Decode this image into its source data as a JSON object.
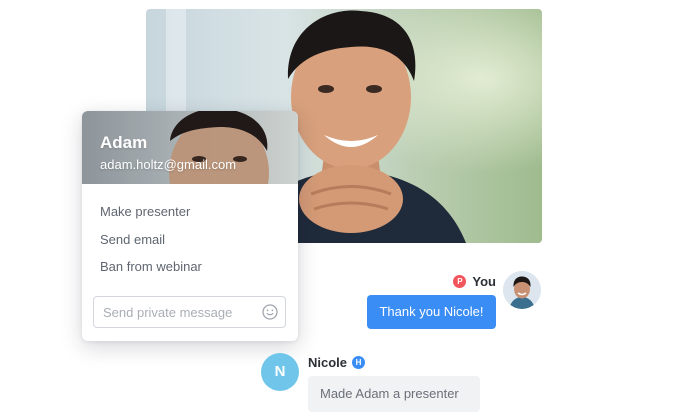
{
  "video": {
    "image": "presenter-video-frame"
  },
  "profile_card": {
    "name": "Adam",
    "email": "adam.holtz@gmail.com",
    "menu": [
      {
        "label": "Make presenter"
      },
      {
        "label": "Send email"
      },
      {
        "label": "Ban from webinar"
      }
    ],
    "message_placeholder": "Send private message",
    "emoji_icon": "emoji-icon"
  },
  "chat": {
    "you": {
      "badge": "P",
      "label": "You",
      "message": "Thank you Nicole!",
      "badge_color": "#f2545b",
      "bubble_color": "#3a8df5"
    },
    "nicole": {
      "initial": "N",
      "label": "Nicole",
      "badge": "H",
      "message": "Made Adam a presenter",
      "avatar_color": "#6fc6ea",
      "badge_color": "#3a8df5"
    }
  }
}
